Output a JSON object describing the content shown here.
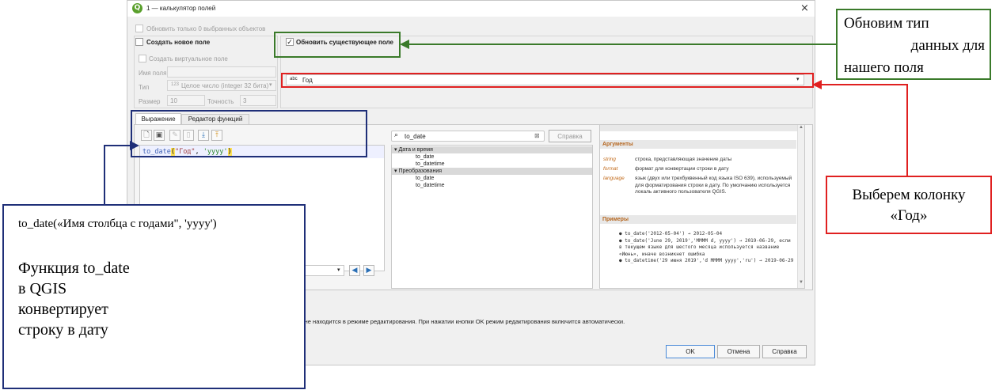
{
  "window": {
    "title": "1 — калькулятор полей",
    "logo": "Q",
    "close": "×"
  },
  "options": {
    "only_selected": "Обновить только 0 выбранных объектов",
    "create_new": "Создать новое поле",
    "create_virtual": "Создать виртуальное поле",
    "field_name_label": "Имя поля",
    "type_label": "Тип",
    "type_value": "Целое число (integer 32 бита)",
    "type_icon": "123",
    "size_label": "Размер",
    "size_value": "10",
    "precision_label": "Точность",
    "precision_value": "3",
    "update_existing": "Обновить существующее поле",
    "field_icon": "abc",
    "field_value": "Год"
  },
  "tabs": {
    "expression": "Выражение",
    "function_editor": "Редактор функций"
  },
  "expression": {
    "func": "to_date",
    "open": "(",
    "arg1": "\"Год\"",
    "sep": ", ",
    "arg2": "'yyyy'",
    "close": ")"
  },
  "functions": {
    "search_value": "to_date",
    "help_button": "Справка",
    "tree": [
      {
        "label": "Дата и время",
        "header": true
      },
      {
        "label": "to_date",
        "header": false
      },
      {
        "label": "to_datetime",
        "header": false
      },
      {
        "label": "Преобразования",
        "header": true
      },
      {
        "label": "to_date",
        "header": false
      },
      {
        "label": "to_datetime",
        "header": false
      }
    ]
  },
  "help": {
    "args_title": "Аргументы",
    "args": [
      {
        "name": "string",
        "desc": "строка, представляющая значение даты"
      },
      {
        "name": "format",
        "desc": "формат для конвертации строки в дату"
      },
      {
        "name": "language",
        "desc": "язык (двух или трехбуквенный код языка ISO 639), используемый для форматирования строки в дату. По умолчанию используется локаль активного пользователя QGIS."
      }
    ],
    "examples_title": "Примеры",
    "examples": [
      "to_date('2012-05-04') → 2012-05-04",
      "to_date('June 29, 2019','MMMM d, yyyy') → 2019-06-29, если в текущем языке для шестого месяца используется название «Июнь», иначе возникнет ошибка",
      "to_datetime('29 июня 2019','d MMMM yyyy','ru') → 2019-06-29"
    ]
  },
  "status_text": "ый не находится в режиме редактирования. При нажатии кнопки OK режим редактирования включится автоматически.",
  "buttons": {
    "ok": "OK",
    "cancel": "Отмена",
    "help": "Справка"
  },
  "annotations": {
    "green_lines": [
      "Обновим тип",
      "данных для",
      "нашего поля"
    ],
    "red_lines": [
      "Выберем колонку",
      "«Год»"
    ],
    "blue_syntax": "to_date(«Имя столбца с годами\", 'yyyy')",
    "blue_lines": [
      "Функция to_date",
      "в QGIS",
      "конвертирует",
      "строку в дату"
    ]
  },
  "colors": {
    "green": "#3a7a2a",
    "red": "#e02020",
    "blue": "#1f2f78"
  }
}
